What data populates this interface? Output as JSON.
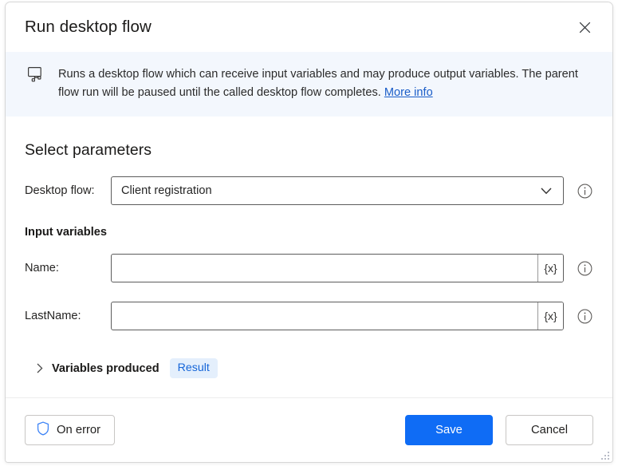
{
  "dialog": {
    "title": "Run desktop flow",
    "close_icon": "close-icon"
  },
  "banner": {
    "icon": "desktop-flow-icon",
    "text": "Runs a desktop flow which can receive input variables and may produce output variables. The parent flow run will be paused until the called desktop flow completes.",
    "link_label": "More info"
  },
  "main": {
    "section_title": "Select parameters",
    "desktop_flow": {
      "label": "Desktop flow:",
      "value": "Client registration",
      "chevron_icon": "chevron-down-icon",
      "info_icon": "info-icon"
    },
    "input_variables_title": "Input variables",
    "inputs": [
      {
        "label": "Name:",
        "value": "",
        "placeholder": "",
        "variable_glyph": "{x}",
        "info_icon": "info-icon"
      },
      {
        "label": "LastName:",
        "value": "",
        "placeholder": "",
        "variable_glyph": "{x}",
        "info_icon": "info-icon"
      }
    ],
    "variables_produced": {
      "expand_icon": "chevron-right-icon",
      "label": "Variables produced",
      "badge": "Result"
    }
  },
  "footer": {
    "on_error_label": "On error",
    "on_error_icon": "shield-icon",
    "save_label": "Save",
    "cancel_label": "Cancel",
    "resize_grip": "resize-grip-icon"
  },
  "colors": {
    "accent": "#0f6cf5",
    "banner_bg": "#f3f7fd",
    "link": "#1a5dc8",
    "badge_bg": "#e4effc",
    "badge_text": "#1565d8",
    "shield": "#3b82f6"
  }
}
